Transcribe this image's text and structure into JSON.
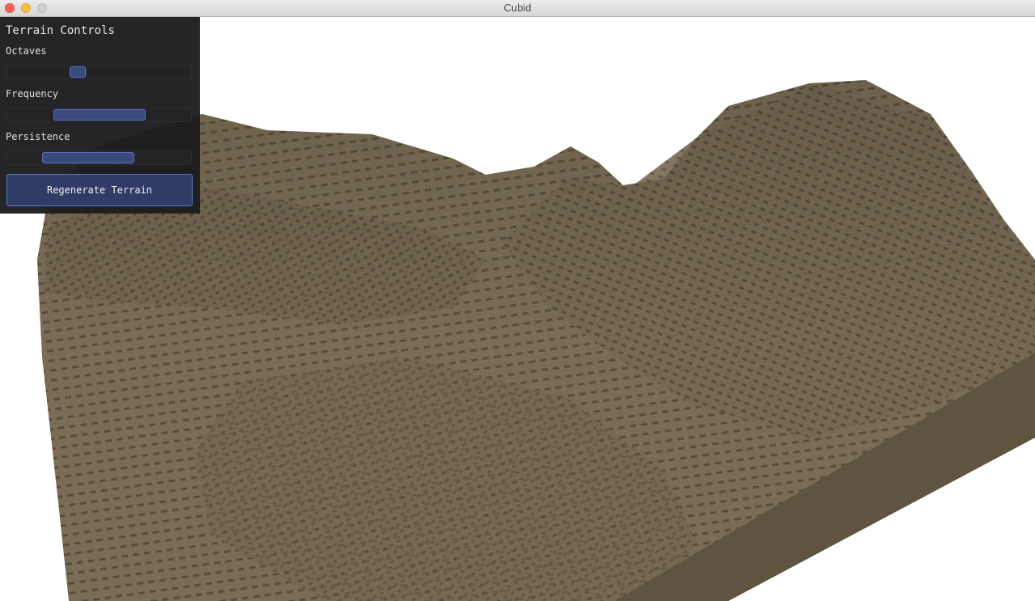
{
  "window": {
    "title": "Cubid"
  },
  "panel": {
    "title": "Terrain Controls",
    "controls": [
      {
        "label": "Octaves",
        "value_fraction": 0.37
      },
      {
        "label": "Frequency",
        "value_fraction": 0.5
      },
      {
        "label": "Persistence",
        "value_fraction": 0.38
      }
    ],
    "regenerate_label": "Regenerate Terrain"
  },
  "colors": {
    "terrain_top": "#7a6c55",
    "terrain_shadow": "#4f4636",
    "terrain_side": "#5e5440",
    "panel_bg": "#1c1c1e",
    "accent": "#5a72c2"
  }
}
